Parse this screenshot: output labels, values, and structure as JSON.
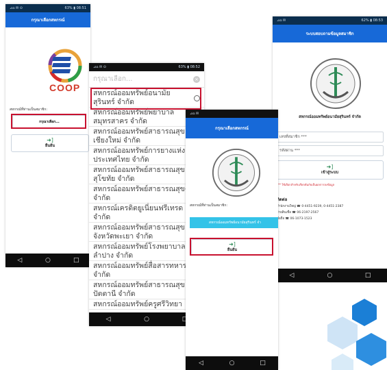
{
  "screen1": {
    "status_left": "⊿⌂ ✉ ⊙",
    "status_right": "63% ▮ 08:51",
    "appbar_title": "กรุณาเลือกสหกรณ์",
    "logo_text": "COOP",
    "member_label": "สหกรณ์ที่ท่านเป็นสมาชิก:",
    "select_value": "กรุณาเลือก...",
    "confirm_label": "ยืนยัน"
  },
  "screen2": {
    "status_left": "⊿⌂ ✉ ⊙",
    "status_right": "63% ▮ 08:52",
    "search_placeholder": "กรุณาเลือก...",
    "items": [
      "สหกรณ์ออมทรัพย์อนามัยสุรินทร์ จำกัด",
      "สหกรณ์ออมทรัพย์พยาบาลสมุทรสาคร จำกัด",
      "สหกรณ์ออมทรัพย์สาธารณสุขเชียงใหม่ จำกัด",
      "สหกรณ์ออมทรัพย์การยางแห่งประเทศไทย จำกัด",
      "สหกรณ์ออมทรัพย์สาธารณสุขสุโขทัย จำกัด",
      "สหกรณ์ออมทรัพย์สาธารณสุขตรัง จำกัด",
      "สหกรณ์เครดิตยูเนี่ยนฟรีเทรด จำกัด",
      "สหกรณ์ออมทรัพย์สาธารณสุขจังหวัดพะเยา จำกัด",
      "สหกรณ์ออมทรัพย์โรงพยาบาลลำปาง จำกัด",
      "สหกรณ์ออมทรัพย์สื่อสารทหาร จำกัด",
      "สหกรณ์ออมทรัพย์สาธารณสุขปัตตานี จำกัด",
      "สหกรณ์ออมทรัพย์ครูศรีวิทยา"
    ]
  },
  "screen3": {
    "status_left": "⊿⌂ ✉",
    "appbar_title": "กรุณาเลือกสหกรณ์",
    "member_label": "สหกรณ์ที่ท่านเป็นสมาชิก:",
    "selected_value": "สหกรณ์ออมทรัพย์อนามัยสุรินทร์ จำ",
    "confirm_label": "ยืนยัน"
  },
  "screen4": {
    "status_left": "⊿⌂ ✉",
    "status_right": "62% ▮ 08:53",
    "appbar_title": "ระบบสอบถามข้อมูลสมาชิก",
    "org_name": "สหกรณ์ออมทรัพย์อนามัยสุรินทร์ จำกัด",
    "member_id_placeholder": "เลขที่สมาชิก ***",
    "password_placeholder": "รหัสผ่าน ***",
    "login_label": "เข้าสู่ระบบ",
    "note": "*** ใช้เลือกสำหรับเรียกค้นกับเป็นผลการลงข้อมูล",
    "contact_title": "ติดต่อ",
    "contact_office": "สำนักงานใหญ่ ☎ 0-4451-9239, 0-4451-2387",
    "contact_branch": "ฝ่ายสินเชื่อ ☎ 06-2197-2567",
    "contact_mobile": "มือถือ ☎ 06-1073-1523"
  },
  "nav": {
    "back": "◁",
    "home": "○",
    "recent": "□"
  },
  "colors": {
    "appbar": "#1769d8",
    "highlight": "#c8102e",
    "cyan_button": "#34c3e8",
    "hex_blue": "#1b7fd6"
  }
}
